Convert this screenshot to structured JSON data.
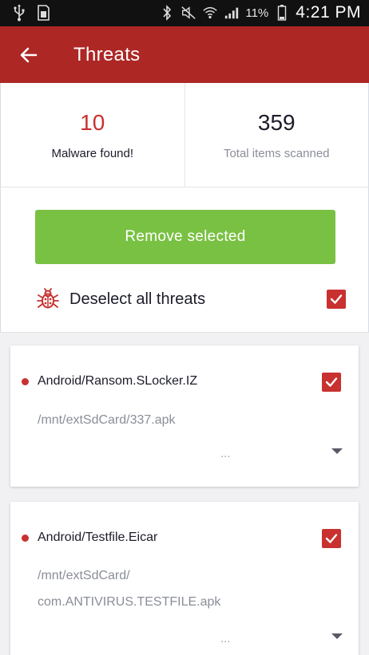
{
  "status_bar": {
    "battery_percent": "11%",
    "time": "4:21 PM"
  },
  "app_bar": {
    "title": "Threats"
  },
  "stats": {
    "malware_count": "10",
    "malware_label": "Malware found!",
    "scanned_count": "359",
    "scanned_label": "Total items scanned"
  },
  "actions": {
    "remove_label": "Remove selected",
    "deselect_label": "Deselect all threats",
    "deselect_checked": true
  },
  "threats": [
    {
      "name": "Android/Ransom.SLocker.IZ",
      "path_lines": [
        "/mnt/extSdCard/337.apk"
      ],
      "more": "...",
      "checked": true
    },
    {
      "name": "Android/Testfile.Eicar",
      "path_lines": [
        "/mnt/extSdCard/",
        "com.ANTIVIRUS.TESTFILE.apk"
      ],
      "more": "...",
      "checked": true
    }
  ],
  "colors": {
    "app_bar": "#ad2725",
    "remove_button": "#79c143",
    "accent_red": "#c8312f",
    "status_bar": "#111111"
  }
}
